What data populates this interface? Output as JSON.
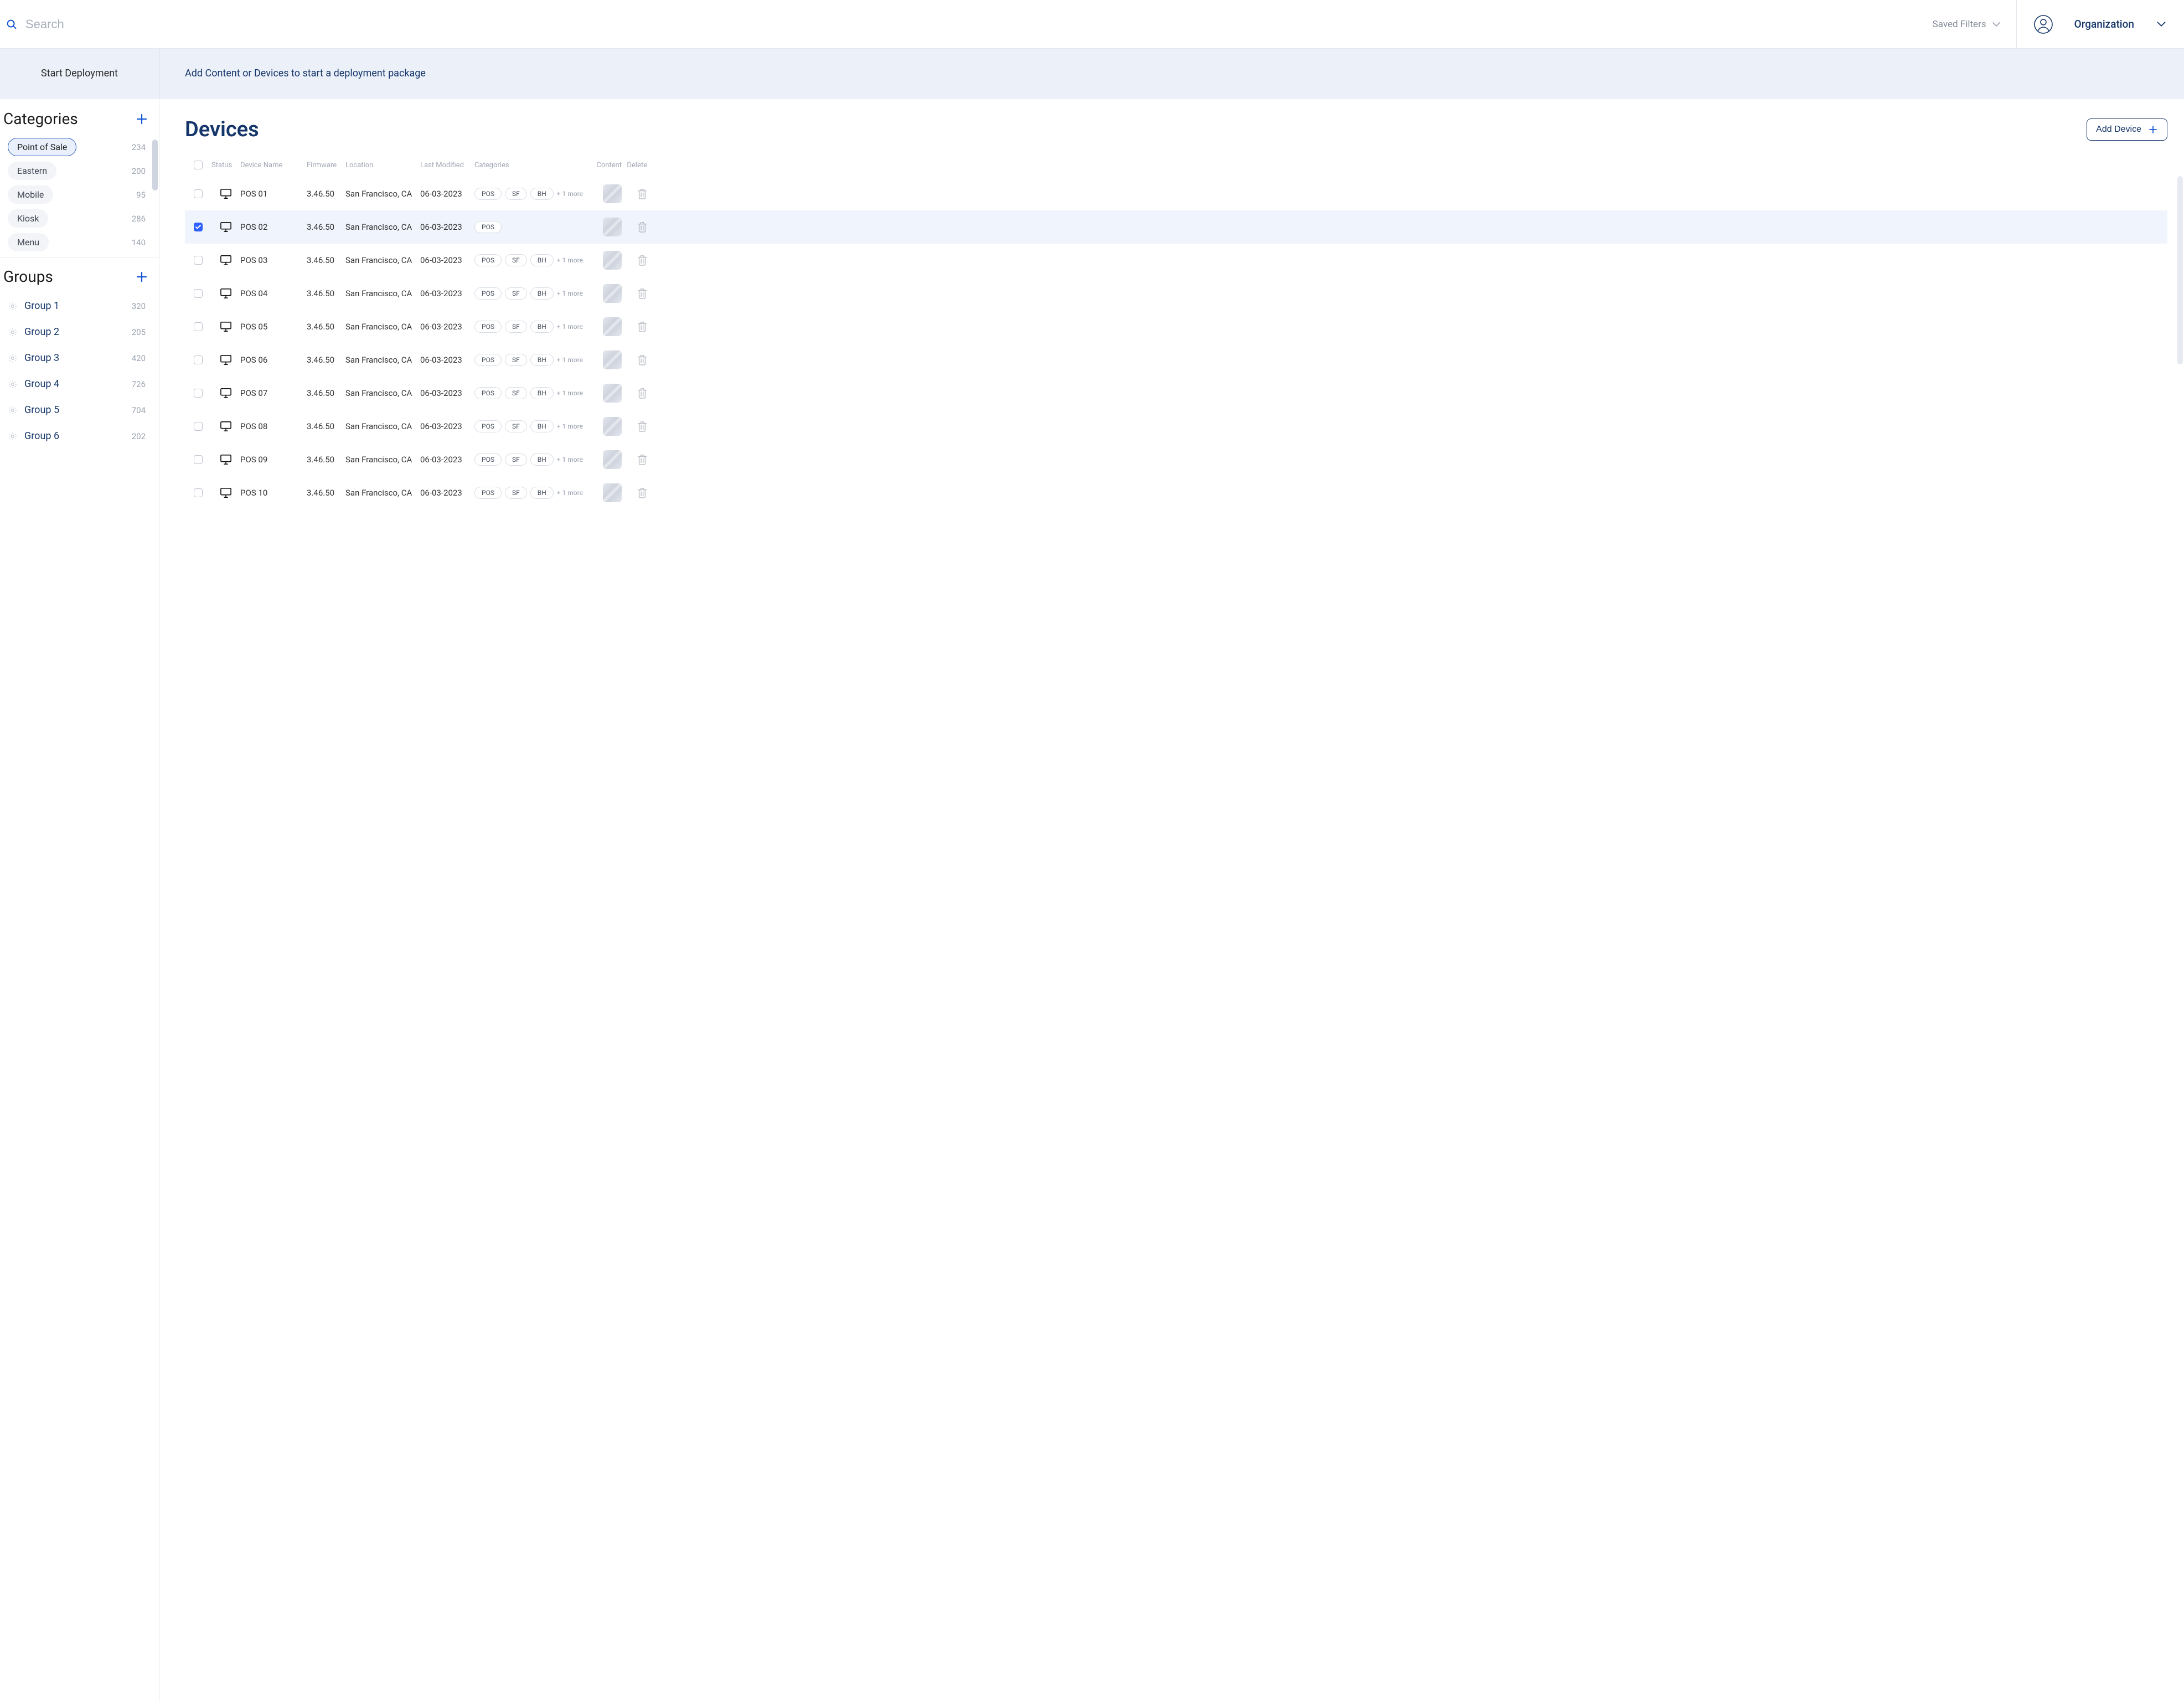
{
  "topbar": {
    "search_placeholder": "Search",
    "saved_filters_label": "Saved Filters",
    "organization_label": "Organization"
  },
  "deploy": {
    "start_label": "Start Deployment",
    "message": "Add Content or Devices to start a deployment package"
  },
  "sidebar": {
    "categories_title": "Categories",
    "groups_title": "Groups",
    "categories": [
      {
        "label": "Point of Sale",
        "count": "234",
        "active": true
      },
      {
        "label": "Eastern",
        "count": "200",
        "active": false
      },
      {
        "label": "Mobile",
        "count": "95",
        "active": false
      },
      {
        "label": "Kiosk",
        "count": "286",
        "active": false
      },
      {
        "label": "Menu",
        "count": "140",
        "active": false
      }
    ],
    "groups": [
      {
        "label": "Group 1",
        "count": "320"
      },
      {
        "label": "Group 2",
        "count": "205"
      },
      {
        "label": "Group 3",
        "count": "420"
      },
      {
        "label": "Group 4",
        "count": "726"
      },
      {
        "label": "Group 5",
        "count": "704"
      },
      {
        "label": "Group 6",
        "count": "202"
      }
    ]
  },
  "content": {
    "title": "Devices",
    "add_button_label": "Add Device",
    "columns": {
      "status": "Status",
      "device_name": "Device Name",
      "firmware": "Firmware",
      "location": "Location",
      "last_modified": "Last Modified",
      "categories": "Categories",
      "content": "Content",
      "delete": "Delete"
    },
    "more_suffix": "+ 1 more",
    "rows": [
      {
        "checked": false,
        "name": "POS 01",
        "firmware": "3.46.50",
        "location": "San Francisco, CA",
        "modified": "06-03-2023",
        "tags": [
          "POS",
          "SF",
          "BH"
        ],
        "more": true
      },
      {
        "checked": true,
        "name": "POS 02",
        "firmware": "3.46.50",
        "location": "San Francisco, CA",
        "modified": "06-03-2023",
        "tags": [
          "POS"
        ],
        "more": false
      },
      {
        "checked": false,
        "name": "POS 03",
        "firmware": "3.46.50",
        "location": "San Francisco, CA",
        "modified": "06-03-2023",
        "tags": [
          "POS",
          "SF",
          "BH"
        ],
        "more": true
      },
      {
        "checked": false,
        "name": "POS 04",
        "firmware": "3.46.50",
        "location": "San Francisco, CA",
        "modified": "06-03-2023",
        "tags": [
          "POS",
          "SF",
          "BH"
        ],
        "more": true
      },
      {
        "checked": false,
        "name": "POS 05",
        "firmware": "3.46.50",
        "location": "San Francisco, CA",
        "modified": "06-03-2023",
        "tags": [
          "POS",
          "SF",
          "BH"
        ],
        "more": true
      },
      {
        "checked": false,
        "name": "POS 06",
        "firmware": "3.46.50",
        "location": "San Francisco, CA",
        "modified": "06-03-2023",
        "tags": [
          "POS",
          "SF",
          "BH"
        ],
        "more": true
      },
      {
        "checked": false,
        "name": "POS 07",
        "firmware": "3.46.50",
        "location": "San Francisco, CA",
        "modified": "06-03-2023",
        "tags": [
          "POS",
          "SF",
          "BH"
        ],
        "more": true
      },
      {
        "checked": false,
        "name": "POS 08",
        "firmware": "3.46.50",
        "location": "San Francisco, CA",
        "modified": "06-03-2023",
        "tags": [
          "POS",
          "SF",
          "BH"
        ],
        "more": true
      },
      {
        "checked": false,
        "name": "POS 09",
        "firmware": "3.46.50",
        "location": "San Francisco, CA",
        "modified": "06-03-2023",
        "tags": [
          "POS",
          "SF",
          "BH"
        ],
        "more": true
      },
      {
        "checked": false,
        "name": "POS 10",
        "firmware": "3.46.50",
        "location": "San Francisco, CA",
        "modified": "06-03-2023",
        "tags": [
          "POS",
          "SF",
          "BH"
        ],
        "more": true
      }
    ]
  }
}
